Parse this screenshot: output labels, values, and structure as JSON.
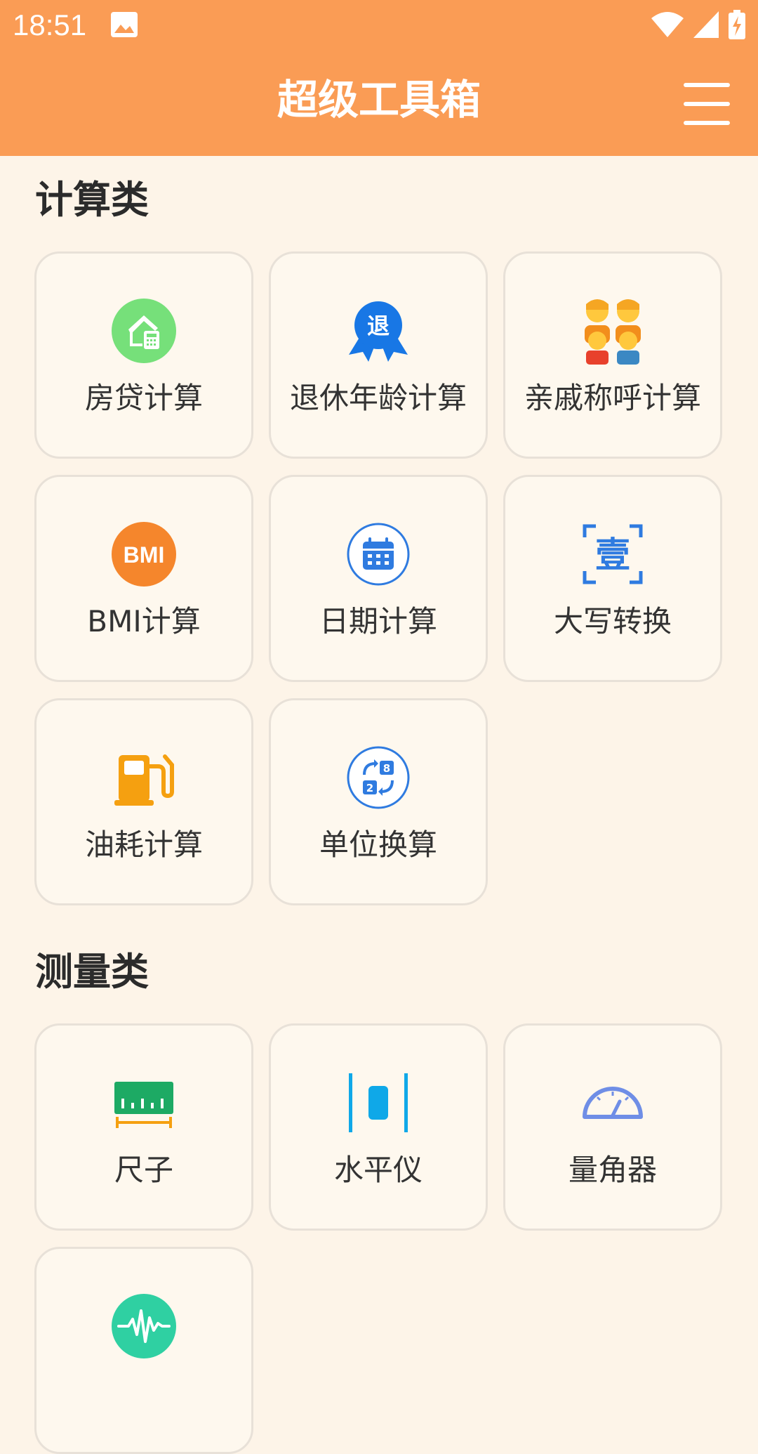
{
  "status_bar": {
    "time": "18:51"
  },
  "app_bar": {
    "title": "超级工具箱"
  },
  "sections": [
    {
      "title": "计算类",
      "items": [
        {
          "label": "房贷计算",
          "icon": "house-calculator-icon"
        },
        {
          "label": "退休年龄计算",
          "icon": "retirement-badge-icon"
        },
        {
          "label": "亲戚称呼计算",
          "icon": "family-icon"
        },
        {
          "label": "BMI计算",
          "icon": "bmi-icon"
        },
        {
          "label": "日期计算",
          "icon": "calendar-icon"
        },
        {
          "label": "大写转换",
          "icon": "uppercase-convert-icon"
        },
        {
          "label": "油耗计算",
          "icon": "fuel-pump-icon"
        },
        {
          "label": "单位换算",
          "icon": "unit-convert-icon"
        }
      ]
    },
    {
      "title": "测量类",
      "items": [
        {
          "label": "尺子",
          "icon": "ruler-icon"
        },
        {
          "label": "水平仪",
          "icon": "spirit-level-icon"
        },
        {
          "label": "量角器",
          "icon": "protractor-icon"
        },
        {
          "label": "",
          "icon": "sound-wave-icon"
        }
      ]
    }
  ],
  "icon_badges": {
    "retire": "退",
    "bmi": "BMI",
    "convert": "壹"
  },
  "colors": {
    "app_bar": "#FA9C55",
    "background": "#FDF4E8",
    "card": "#FEF8EE",
    "house": "#76E07A",
    "retire": "#1877E5",
    "bmi": "#F5862C",
    "calendar": "#2F7BE0",
    "fuel": "#F5A010",
    "ruler": "#1DAA64",
    "level": "#0FA8E8",
    "protractor": "#6F8EE6",
    "sound": "#2FD0A2"
  }
}
